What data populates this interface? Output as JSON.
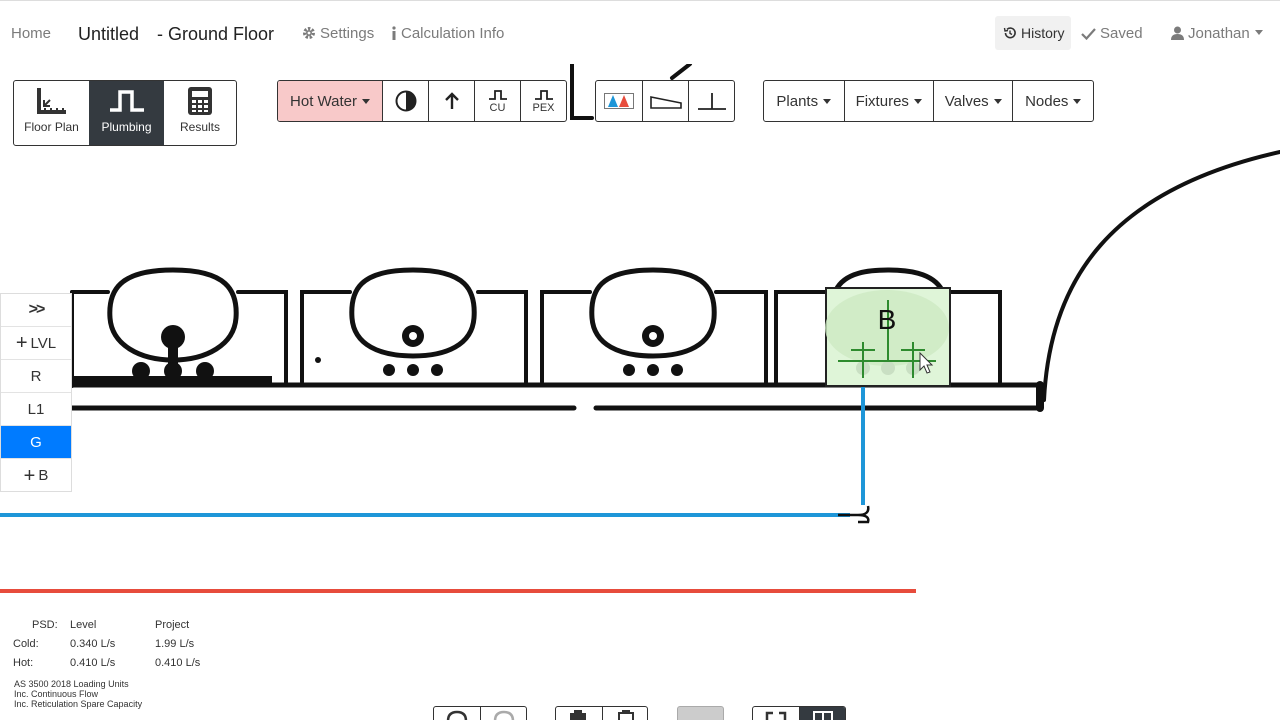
{
  "nav": {
    "home": "Home",
    "title": "Untitled",
    "level_title": "- Ground Floor",
    "settings": "Settings",
    "calc_info": "Calculation Info",
    "history": "History",
    "saved": "Saved",
    "user": "Jonathan"
  },
  "modes": [
    {
      "label": "Floor Plan",
      "icon": "floor-plan-icon"
    },
    {
      "label": "Plumbing",
      "icon": "plumbing-icon",
      "active": true
    },
    {
      "label": "Results",
      "icon": "calculator-icon"
    }
  ],
  "system": {
    "selected": "Hot Water",
    "color": "#f8c9c9"
  },
  "tools": {
    "cu": "CU",
    "pex": "PEX"
  },
  "menus": {
    "plants": "Plants",
    "fixtures": "Fixtures",
    "valves": "Valves",
    "nodes": "Nodes"
  },
  "levels": {
    "expand": ">>",
    "add_level": "LVL",
    "items": [
      "R",
      "L1",
      "G"
    ],
    "active": "G",
    "add_below": "B"
  },
  "fixture_label": "B",
  "psd": {
    "header_label": "PSD:",
    "col_level": "Level",
    "col_project": "Project",
    "cold_label": "Cold:",
    "cold_level": "0.340 L/s",
    "cold_project": "1.99 L/s",
    "hot_label": "Hot:",
    "hot_level": "0.410 L/s",
    "hot_project": "0.410 L/s",
    "notes": [
      "AS 3500 2018 Loading Units",
      "Inc. Continuous Flow",
      "Inc. Reticulation Spare Capacity"
    ]
  },
  "colors": {
    "cold_pipe": "#1e96d8",
    "hot_pipe": "#e74c3c",
    "active_level": "#007bff",
    "active_mode": "#343a40",
    "fixture_fill": "#dff5d8",
    "fixture_outlet": "#2e8b2e"
  }
}
